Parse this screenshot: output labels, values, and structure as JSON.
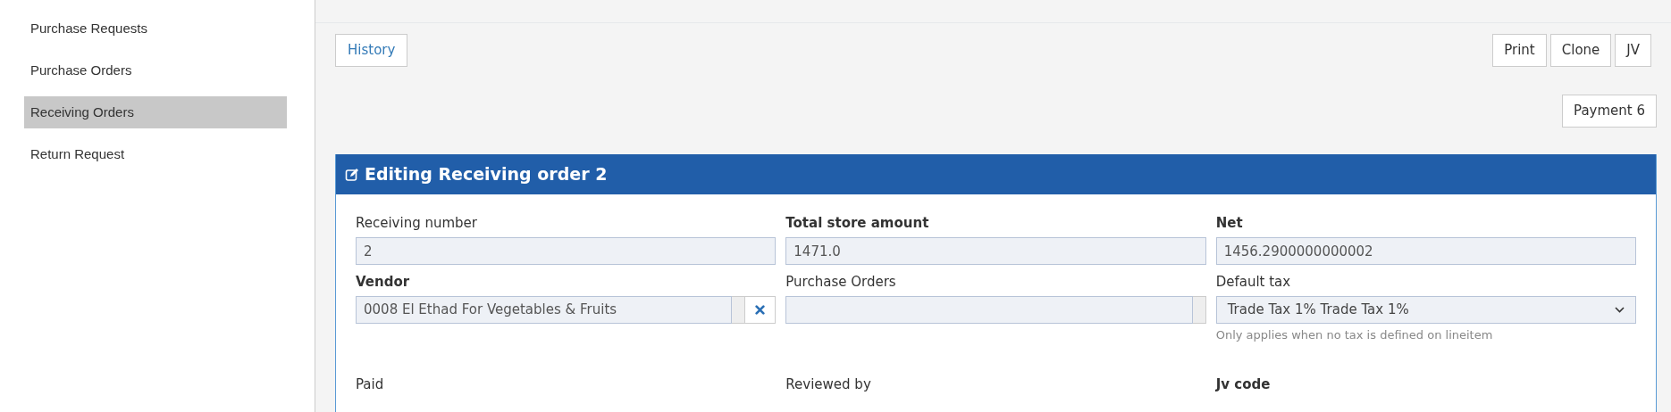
{
  "sidebar": {
    "items": [
      {
        "label": "Purchase Requests",
        "selected": false
      },
      {
        "label": "Purchase Orders",
        "selected": false
      },
      {
        "label": "Receiving Orders",
        "selected": true
      },
      {
        "label": "Return Request",
        "selected": false
      }
    ]
  },
  "toolbar": {
    "left_buttons": [
      "History"
    ],
    "right_buttons": [
      "Print",
      "Clone",
      "JV"
    ],
    "secondary_buttons": [
      "Payment 6"
    ]
  },
  "panel": {
    "title": "Editing Receiving order 2",
    "fields": [
      {
        "label": "Receiving number",
        "bold": false,
        "kind": "text",
        "value": "2"
      },
      {
        "label": "Total store amount",
        "bold": true,
        "kind": "text",
        "value": "1471.0"
      },
      {
        "label": "Net",
        "bold": true,
        "kind": "text",
        "value": "1456.2900000000002"
      },
      {
        "label": "Vendor",
        "bold": true,
        "kind": "lookup",
        "value": "0008 El Ethad For Vegetables & Fruits",
        "clearable": true
      },
      {
        "label": "Purchase Orders",
        "bold": false,
        "kind": "lookup",
        "clearable": false
      },
      {
        "label": "Default tax",
        "bold": false,
        "kind": "select",
        "value": "Trade Tax 1% Trade Tax 1%",
        "help": "Only applies when no tax is defined on lineitem"
      },
      {
        "label": "Paid",
        "bold": false,
        "kind": "label_only"
      },
      {
        "label": "Reviewed by",
        "bold": false,
        "kind": "label_only"
      },
      {
        "label": "Jv code",
        "bold": true,
        "kind": "label_only"
      }
    ]
  }
}
